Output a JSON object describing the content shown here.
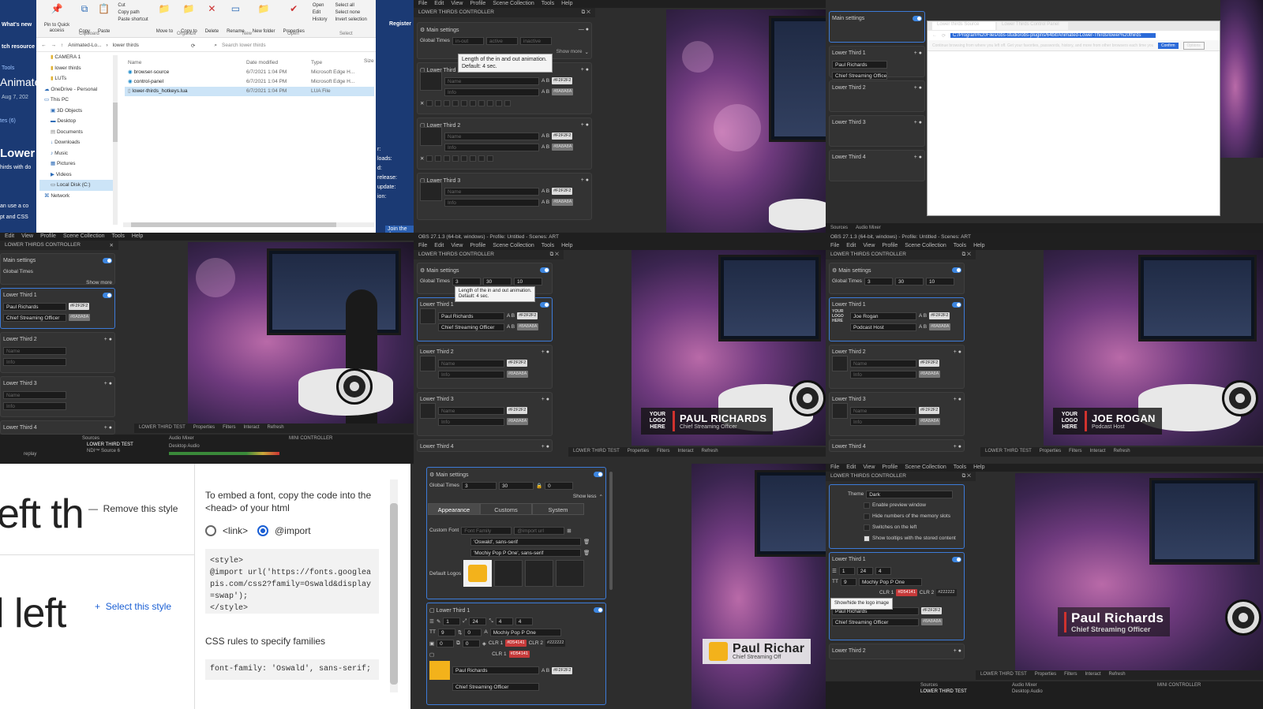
{
  "explorer": {
    "ribbon": {
      "pin": "Pin to Quick access",
      "copy": "Copy",
      "paste": "Paste",
      "cut": "Cut",
      "copy_path": "Copy path",
      "paste_shortcut": "Paste shortcut",
      "move_to": "Move to",
      "copy_to": "Copy to",
      "delete": "Delete",
      "rename": "Rename",
      "new_folder": "New folder",
      "properties": "Properties",
      "open": "Open",
      "edit": "Edit",
      "history": "History",
      "select_all": "Select all",
      "select_none": "Select none",
      "invert_selection": "Invert selection",
      "groups": [
        "Clipboard",
        "Organize",
        "New",
        "Open",
        "Select"
      ]
    },
    "breadcrumb": [
      "Animated-Lo...",
      "lower thirds"
    ],
    "search_placeholder": "Search lower thirds",
    "nav": [
      "CAMERA 1",
      "lower thirds",
      "LUTs",
      "OneDrive - Personal",
      "This PC",
      "3D Objects",
      "Desktop",
      "Documents",
      "Downloads",
      "Music",
      "Pictures",
      "Videos",
      "Local Disk (C:)",
      "Network"
    ],
    "columns": [
      "Name",
      "Date modified",
      "Type",
      "Size"
    ],
    "files": [
      {
        "name": "browser-source",
        "date": "6/7/2021 1:04 PM",
        "type": "Microsoft Edge H..."
      },
      {
        "name": "control-panel",
        "date": "6/7/2021 1:04 PM",
        "type": "Microsoft Edge H..."
      },
      {
        "name": "lower-thirds_hotkeys.lua",
        "date": "6/7/2021 1:04 PM",
        "type": "LUA File"
      }
    ]
  },
  "site_left": {
    "whats_new": "What's new",
    "tch_resource": "tch resource",
    "tools": "Tools",
    "animate": "Animate",
    "date": "Aug 7, 202",
    "tes": "tes (6)",
    "lower": "Lower",
    "hirds": "hirds with do",
    "an_use": "an use a co",
    "css": "pt and CSS"
  },
  "site_right": {
    "register": "Register",
    "r": "r:",
    "loads": "loads:",
    "d": "d:",
    "release": "release:",
    "update": "update:",
    "ion": "ion:",
    "join": "Join the d"
  },
  "obs": {
    "menu": [
      "File",
      "Edit",
      "View",
      "Profile",
      "Scene Collection",
      "Tools",
      "Help"
    ],
    "window_title": "OBS 27.1.3 (64-bit, windows) - Profile: Untitled - Scenes: ART",
    "dock_title": "LOWER THIRDS CONTROLLER",
    "main_settings": "Main settings",
    "global_times": "Global Times",
    "gt_in": "in-out",
    "gt_active": "active",
    "gt_inactive": "inactive",
    "gt_values": [
      "3",
      "30",
      "10"
    ],
    "show_more": "Show more",
    "show_less": "Show less",
    "tooltip": "Length of the in and out animation.\nDefault: 4 sec.",
    "lower_third_1": "Lower Third 1",
    "lower_third_2": "Lower Third 2",
    "lower_third_3": "Lower Third 3",
    "lower_third_4": "Lower Third 4",
    "name_ph": "Name",
    "info_ph": "Info",
    "chip_white": "#F2F2F2",
    "chip_grey": "#8A8A8A",
    "lt_name": "Paul Richards",
    "lt_info": "Chief Streaming Officer",
    "jr_name": "Joe Rogan",
    "jr_info": "Podcast Host",
    "logo_text": "YOUR LOGO HERE",
    "scene": "LOWER THIRD TEST",
    "dock_buttons": [
      "Properties",
      "Filters",
      "Interact",
      "Refresh"
    ],
    "docks": [
      "Sources",
      "Audio Mixer",
      "MINI CONTROLLER"
    ],
    "desktop_audio": "Desktop Audio",
    "replay": "replay",
    "source": "NDI™ Source 6"
  },
  "preview": {
    "pr_name": "PAUL RICHARDS",
    "pr_sub": "Chief Streaming Officer",
    "jr_name": "JOE ROGAN",
    "jr_sub": "Podcast Host",
    "logo": "YOUR LOGO HERE",
    "pr2_name": "Paul Richards",
    "pr2_sub": "Chief Streaming Officer"
  },
  "fonts_page": {
    "remove_style": "Remove this style",
    "select_style": "Select this style",
    "large_1": "eft th",
    "large_2": "l left",
    "embed": "To embed a font, copy the code into the <head> of your html",
    "opt_link": "<link>",
    "opt_import": "@import",
    "code": "<style>\n@import url('https://fonts.googlea\npis.com/css2?family=Oswald&display\n=swap');\n</style>",
    "css_rules": "CSS rules to specify families",
    "css_code": "font-family: 'Oswald', sans-serif;"
  },
  "expanded": {
    "tabs": [
      "Appearance",
      "Customs",
      "System"
    ],
    "custom_font": "Custom Font",
    "font_family_ph": "Font Family",
    "import_url_ph": "@import url",
    "fonts": [
      "'Oswald', sans-serif",
      "'Mochiy Pop P One', sans-serif"
    ],
    "default_logos": "Default Logos",
    "gt": [
      "3",
      "30",
      "0"
    ],
    "font_select": "Mochiy Pop P One",
    "nums": [
      "1",
      "24",
      "4",
      "4",
      "9",
      "0",
      "0",
      "0"
    ],
    "clr1": "CLR 1",
    "clr2": "CLR 2",
    "c1": "#D54141",
    "c2": "#222222",
    "pr_name": "Paul Richar",
    "pr_sub": "Chief Streaming Off"
  },
  "theme_panel": {
    "theme_label": "Theme",
    "theme_value": "Dark",
    "options": [
      "Enable preview window",
      "Hide numbers of the memory slots",
      "Switches on the left",
      "Show tooltips with the stored content"
    ],
    "tooltip": "Show/hide the logo image"
  },
  "browser": {
    "tab1": "Lower thirds Source",
    "tab2": "Lower Thirds Control Panel",
    "url": "C:/Program%20Files/obs-studio/obs-plugins/64bit/Animated-Lower-Thirds/lower%20thirds",
    "notice": "Continue browsing from where you left off. Get your favorites, passwords, history, and more from other browsers each time you brow...  Microsoft Privacy Statement",
    "confirm": "Confirm",
    "options": "Options"
  }
}
